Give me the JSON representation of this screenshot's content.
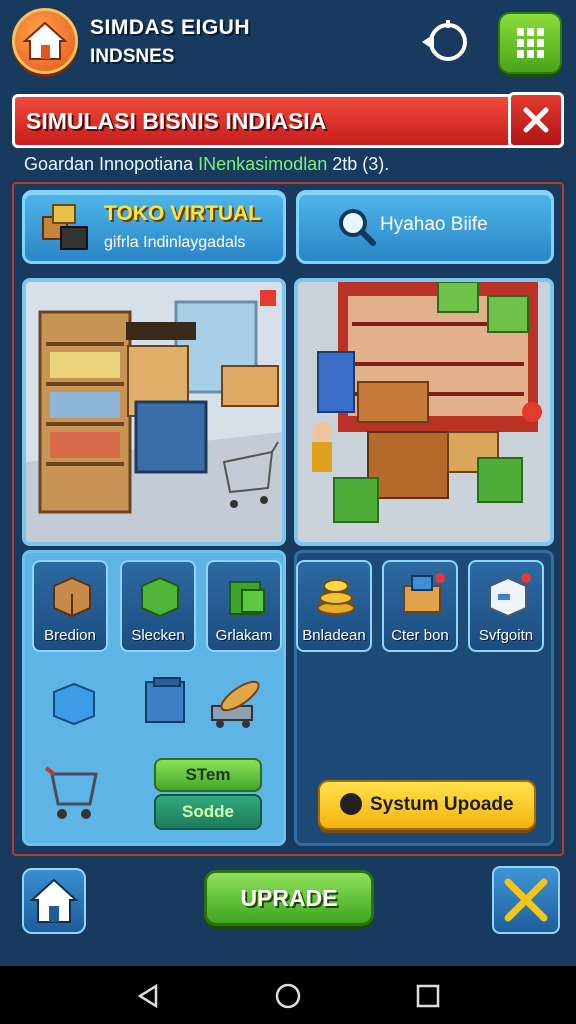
{
  "header": {
    "title": "SIMDAS EIGUH",
    "subtitle": "INDSNES"
  },
  "banner": {
    "title": "SIMULASI BISNIS INDIASIA"
  },
  "subtitle": {
    "part1": "Goardan Innopotiana ",
    "part2": "INenkasimodlan",
    "part3": " 2tb (3)."
  },
  "toko": {
    "title": "TOKO VIRTUAL",
    "sub": "gifrla Indinlaygadals"
  },
  "search": {
    "label": "Hyahao Biife"
  },
  "items_left": [
    {
      "label": "Bredion",
      "icon": "box-icon"
    },
    {
      "label": "Slecken",
      "icon": "green-box-icon"
    },
    {
      "label": "Grlakam",
      "icon": "green-bag-icon"
    }
  ],
  "items_right": [
    {
      "label": "Bnladean",
      "icon": "coins-icon"
    },
    {
      "label": "Cter bon",
      "icon": "crate-icon"
    },
    {
      "label": "Svfgoitn",
      "icon": "white-box-icon"
    }
  ],
  "buttons": {
    "stem": "STem",
    "sodo": "Sodde",
    "system_upgrade": "Systum Upoade",
    "upgrade": "UPRADE"
  },
  "colors": {
    "background": "#173a5e",
    "banner_red": "#d42a22",
    "accent_green": "#4aa51c",
    "accent_yellow": "#f5b40f"
  }
}
